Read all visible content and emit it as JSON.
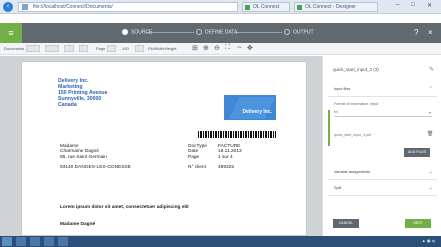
{
  "browser": {
    "url": "file:///localhost/Connect/Documents/",
    "tabs": [
      {
        "label": "OL Connect"
      },
      {
        "label": "OL Connect - Designer"
      }
    ]
  },
  "app": {
    "steps": [
      {
        "label": "SOURCE"
      },
      {
        "label": "DEFINE DATA"
      },
      {
        "label": "OUTPUT"
      }
    ],
    "icons": [
      "menu-icon",
      "help-icon",
      "close-icon"
    ]
  },
  "toolbar": {
    "documents_label": "Documents",
    "page_label": "Page",
    "zoom_value": "100",
    "fit_label": "Fit/Width/Height"
  },
  "document": {
    "sender": [
      "Delivery Inc.",
      "Marketing",
      "150 Printing Avenue",
      "Sunnyville, 30000",
      "Canada"
    ],
    "logo_text": "Delivery Inc.",
    "recipient": [
      "Madame",
      "Charmaine Dagné",
      "85, rue Saint Germain"
    ],
    "city": "93140 DANGES-LES-GONESSE",
    "meta_labels": [
      "DocType",
      "Date",
      "Page"
    ],
    "meta_values": [
      "FACTURE",
      "18.11.2013",
      "1 sur 4"
    ],
    "client_label": "N° client",
    "client_value": "489325",
    "body": "Lorem ipsum dolor sit amet, consectetuer adipiscing elit",
    "signature": "Madame Dagné"
  },
  "panel": {
    "title": "quick_start_input_3 (3)",
    "sections": [
      {
        "label": "Input files"
      },
      {
        "label": "Variable assignments"
      },
      {
        "label": "Split"
      }
    ],
    "format_label": "Format of information: Input",
    "format_value": "txt",
    "file_item": "quick_start_input_3.pdf",
    "add_label": "ADD FILES",
    "cancel_label": "CANCEL",
    "next_label": "NEXT"
  },
  "colors": {
    "accent_green": "#72b047",
    "app_bar": "#616a70",
    "logo_blue": "#3f86d6",
    "address_blue": "#2e63b5"
  }
}
